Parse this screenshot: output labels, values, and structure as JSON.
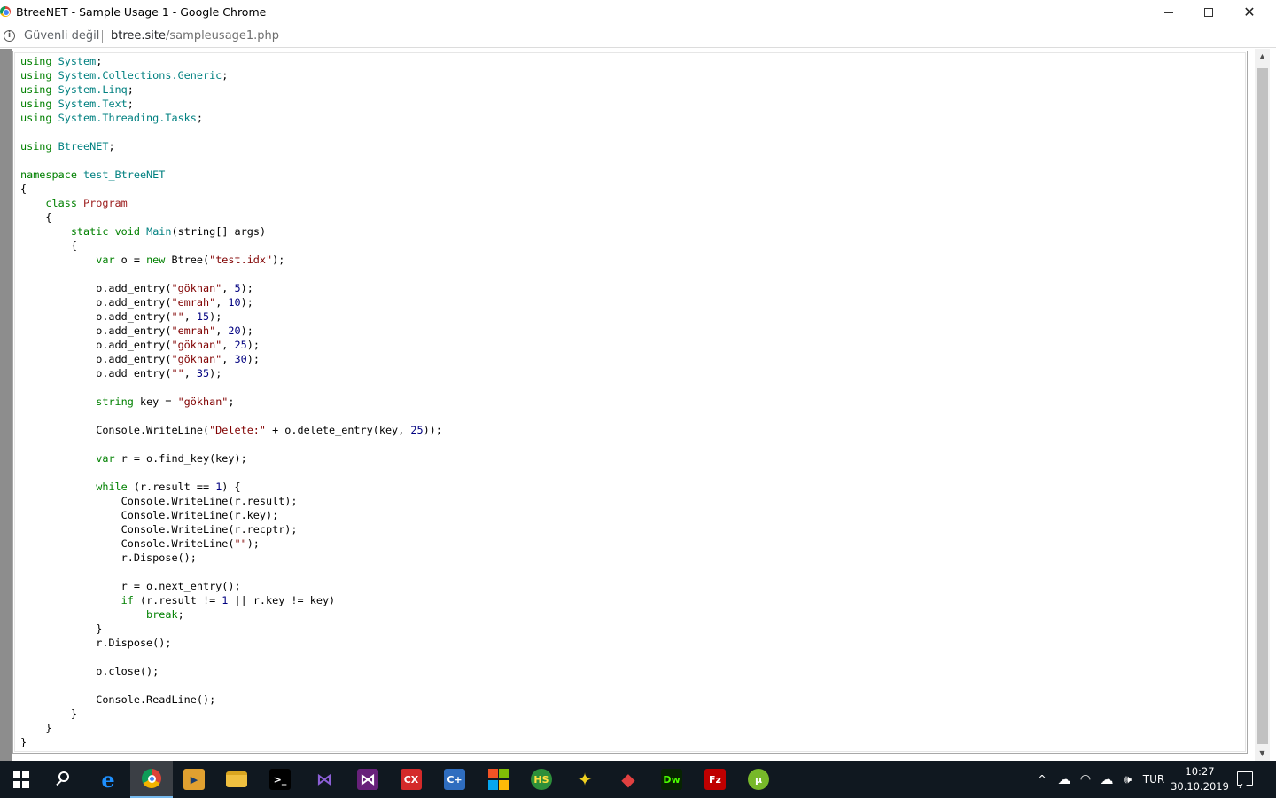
{
  "window": {
    "title": "BtreeNET - Sample Usage 1 - Google Chrome",
    "minimize_icon": "minimize-icon",
    "maximize_icon": "maximize-icon",
    "close_icon": "close-icon",
    "close_glyph": "✕"
  },
  "address_bar": {
    "info_glyph": "i",
    "security_label": "Güvenli değil",
    "url_host": "btree.site",
    "url_path": "/sampleusage1.php"
  },
  "code_lines": [
    [
      [
        "kw",
        "using"
      ],
      [
        "plain",
        " "
      ],
      [
        "ns",
        "System"
      ],
      [
        "plain",
        ";"
      ]
    ],
    [
      [
        "kw",
        "using"
      ],
      [
        "plain",
        " "
      ],
      [
        "ns",
        "System.Collections.Generic"
      ],
      [
        "plain",
        ";"
      ]
    ],
    [
      [
        "kw",
        "using"
      ],
      [
        "plain",
        " "
      ],
      [
        "ns",
        "System.Linq"
      ],
      [
        "plain",
        ";"
      ]
    ],
    [
      [
        "kw",
        "using"
      ],
      [
        "plain",
        " "
      ],
      [
        "ns",
        "System.Text"
      ],
      [
        "plain",
        ";"
      ]
    ],
    [
      [
        "kw",
        "using"
      ],
      [
        "plain",
        " "
      ],
      [
        "ns",
        "System.Threading.Tasks"
      ],
      [
        "plain",
        ";"
      ]
    ],
    [],
    [
      [
        "kw",
        "using"
      ],
      [
        "plain",
        " "
      ],
      [
        "ns",
        "BtreeNET"
      ],
      [
        "plain",
        ";"
      ]
    ],
    [],
    [
      [
        "kw",
        "namespace"
      ],
      [
        "plain",
        " "
      ],
      [
        "ns",
        "test_BtreeNET"
      ]
    ],
    [
      [
        "plain",
        "{"
      ]
    ],
    [
      [
        "plain",
        "    "
      ],
      [
        "kw",
        "class"
      ],
      [
        "plain",
        " "
      ],
      [
        "cls",
        "Program"
      ]
    ],
    [
      [
        "plain",
        "    {"
      ]
    ],
    [
      [
        "plain",
        "        "
      ],
      [
        "kw",
        "static"
      ],
      [
        "plain",
        " "
      ],
      [
        "kw",
        "void"
      ],
      [
        "plain",
        " "
      ],
      [
        "fn",
        "Main"
      ],
      [
        "plain",
        "(string[] args)"
      ]
    ],
    [
      [
        "plain",
        "        {"
      ]
    ],
    [
      [
        "plain",
        "            "
      ],
      [
        "kw",
        "var"
      ],
      [
        "plain",
        " o = "
      ],
      [
        "kw",
        "new"
      ],
      [
        "plain",
        " Btree("
      ],
      [
        "str",
        "\"test.idx\""
      ],
      [
        "plain",
        ");"
      ]
    ],
    [],
    [
      [
        "plain",
        "            o.add_entry("
      ],
      [
        "str",
        "\"gökhan\""
      ],
      [
        "plain",
        ", "
      ],
      [
        "num",
        "5"
      ],
      [
        "plain",
        ");"
      ]
    ],
    [
      [
        "plain",
        "            o.add_entry("
      ],
      [
        "str",
        "\"emrah\""
      ],
      [
        "plain",
        ", "
      ],
      [
        "num",
        "10"
      ],
      [
        "plain",
        ");"
      ]
    ],
    [
      [
        "plain",
        "            o.add_entry("
      ],
      [
        "str",
        "\"\""
      ],
      [
        "plain",
        ", "
      ],
      [
        "num",
        "15"
      ],
      [
        "plain",
        ");"
      ]
    ],
    [
      [
        "plain",
        "            o.add_entry("
      ],
      [
        "str",
        "\"emrah\""
      ],
      [
        "plain",
        ", "
      ],
      [
        "num",
        "20"
      ],
      [
        "plain",
        ");"
      ]
    ],
    [
      [
        "plain",
        "            o.add_entry("
      ],
      [
        "str",
        "\"gökhan\""
      ],
      [
        "plain",
        ", "
      ],
      [
        "num",
        "25"
      ],
      [
        "plain",
        ");"
      ]
    ],
    [
      [
        "plain",
        "            o.add_entry("
      ],
      [
        "str",
        "\"gökhan\""
      ],
      [
        "plain",
        ", "
      ],
      [
        "num",
        "30"
      ],
      [
        "plain",
        ");"
      ]
    ],
    [
      [
        "plain",
        "            o.add_entry("
      ],
      [
        "str",
        "\"\""
      ],
      [
        "plain",
        ", "
      ],
      [
        "num",
        "35"
      ],
      [
        "plain",
        ");"
      ]
    ],
    [],
    [
      [
        "plain",
        "            "
      ],
      [
        "kw",
        "string"
      ],
      [
        "plain",
        " key = "
      ],
      [
        "str",
        "\"gökhan\""
      ],
      [
        "plain",
        ";"
      ]
    ],
    [],
    [
      [
        "plain",
        "            Console.WriteLine("
      ],
      [
        "str",
        "\"Delete:\""
      ],
      [
        "plain",
        " + o.delete_entry(key, "
      ],
      [
        "num",
        "25"
      ],
      [
        "plain",
        "));"
      ]
    ],
    [],
    [
      [
        "plain",
        "            "
      ],
      [
        "kw",
        "var"
      ],
      [
        "plain",
        " r = o.find_key(key);"
      ]
    ],
    [],
    [
      [
        "plain",
        "            "
      ],
      [
        "kw",
        "while"
      ],
      [
        "plain",
        " (r.result == "
      ],
      [
        "num",
        "1"
      ],
      [
        "plain",
        ") {"
      ]
    ],
    [
      [
        "plain",
        "                Console.WriteLine(r.result);"
      ]
    ],
    [
      [
        "plain",
        "                Console.WriteLine(r.key);"
      ]
    ],
    [
      [
        "plain",
        "                Console.WriteLine(r.recptr);"
      ]
    ],
    [
      [
        "plain",
        "                Console.WriteLine("
      ],
      [
        "str",
        "\"\""
      ],
      [
        "plain",
        ");"
      ]
    ],
    [
      [
        "plain",
        "                r.Dispose();"
      ]
    ],
    [],
    [
      [
        "plain",
        "                r = o.next_entry();"
      ]
    ],
    [
      [
        "plain",
        "                "
      ],
      [
        "kw",
        "if"
      ],
      [
        "plain",
        " (r.result != "
      ],
      [
        "num",
        "1"
      ],
      [
        "plain",
        " || r.key != key)"
      ]
    ],
    [
      [
        "plain",
        "                    "
      ],
      [
        "kw",
        "break"
      ],
      [
        "plain",
        ";"
      ]
    ],
    [
      [
        "plain",
        "            }"
      ]
    ],
    [
      [
        "plain",
        "            r.Dispose();"
      ]
    ],
    [],
    [
      [
        "plain",
        "            o.close();"
      ]
    ],
    [],
    [
      [
        "plain",
        "            Console.ReadLine();"
      ]
    ],
    [
      [
        "plain",
        "        }"
      ]
    ],
    [
      [
        "plain",
        "    }"
      ]
    ],
    [
      [
        "plain",
        "}"
      ]
    ]
  ],
  "scrollbar": {
    "up_arrow": "▲",
    "down_arrow": "▼",
    "position_fraction": 0.0
  },
  "taskbar": {
    "items": [
      {
        "id": "start",
        "icon": "windows-start-icon",
        "label": "",
        "bg": "transparent",
        "active": false
      },
      {
        "id": "search",
        "icon": "search-icon",
        "label": "",
        "bg": "transparent",
        "active": false
      },
      {
        "id": "edge",
        "icon": "edge-icon",
        "label": "e",
        "bg": "transparent",
        "color": "#1e90ff",
        "active": false
      },
      {
        "id": "chrome",
        "icon": "chrome-icon",
        "label": "",
        "bg": "transparent",
        "active": true
      },
      {
        "id": "media",
        "icon": "media-player-icon",
        "label": "▶",
        "bg": "#e0a030",
        "color": "#1a3d6e",
        "active": false
      },
      {
        "id": "explorer",
        "icon": "file-explorer-icon",
        "label": "",
        "bg": "#f0c040",
        "active": false
      },
      {
        "id": "terminal",
        "icon": "terminal-icon",
        "label": ">_",
        "bg": "#000000",
        "color": "#ffffff",
        "active": false
      },
      {
        "id": "vs-code",
        "icon": "visual-studio-icon",
        "label": "⋈",
        "bg": "transparent",
        "color": "#8c5fd6",
        "active": false
      },
      {
        "id": "vs",
        "icon": "visual-studio-2-icon",
        "label": "⋈",
        "bg": "#68217a",
        "color": "#ffffff",
        "active": false
      },
      {
        "id": "cx",
        "icon": "cx-icon",
        "label": "CX",
        "bg": "#d42a2a",
        "color": "#ffffff",
        "active": false
      },
      {
        "id": "cppbuilder",
        "icon": "cpp-builder-icon",
        "label": "C+",
        "bg": "#2f6dbf",
        "color": "#ffffff",
        "active": false
      },
      {
        "id": "winapp",
        "icon": "windows-app-icon",
        "label": "",
        "bg": "#d94020",
        "active": false
      },
      {
        "id": "hs",
        "icon": "hs-icon",
        "label": "HS",
        "bg": "#2d8f3a",
        "color": "#ffe040",
        "active": false
      },
      {
        "id": "tool",
        "icon": "yellow-tool-icon",
        "label": "✦",
        "bg": "transparent",
        "color": "#f0d020",
        "active": false
      },
      {
        "id": "red-app",
        "icon": "red-app-icon",
        "label": "◆",
        "bg": "transparent",
        "color": "#e04040",
        "active": false
      },
      {
        "id": "dreamweaver",
        "icon": "dreamweaver-icon",
        "label": "Dw",
        "bg": "#072401",
        "color": "#4bff00",
        "active": false
      },
      {
        "id": "filezilla",
        "icon": "filezilla-icon",
        "label": "Fz",
        "bg": "#bf0000",
        "color": "#ffffff",
        "active": false
      },
      {
        "id": "utorrent",
        "icon": "utorrent-icon",
        "label": "µ",
        "bg": "#77b82a",
        "color": "#ffffff",
        "active": false
      }
    ],
    "tray": {
      "chevron_icon": "chevron-up-icon",
      "chevron_glyph": "^",
      "onedrive_icon": "onedrive-cloud-icon",
      "onedrive_glyph": "☁",
      "wifi_icon": "wifi-icon",
      "wifi_glyph": "◠",
      "upload_icon": "cloud-upload-icon",
      "upload_glyph": "☁",
      "volume_icon": "volume-icon",
      "volume_glyph": "🕪",
      "language": "TUR",
      "time": "10:27",
      "date": "30.10.2019",
      "notification_icon": "notification-icon"
    }
  }
}
